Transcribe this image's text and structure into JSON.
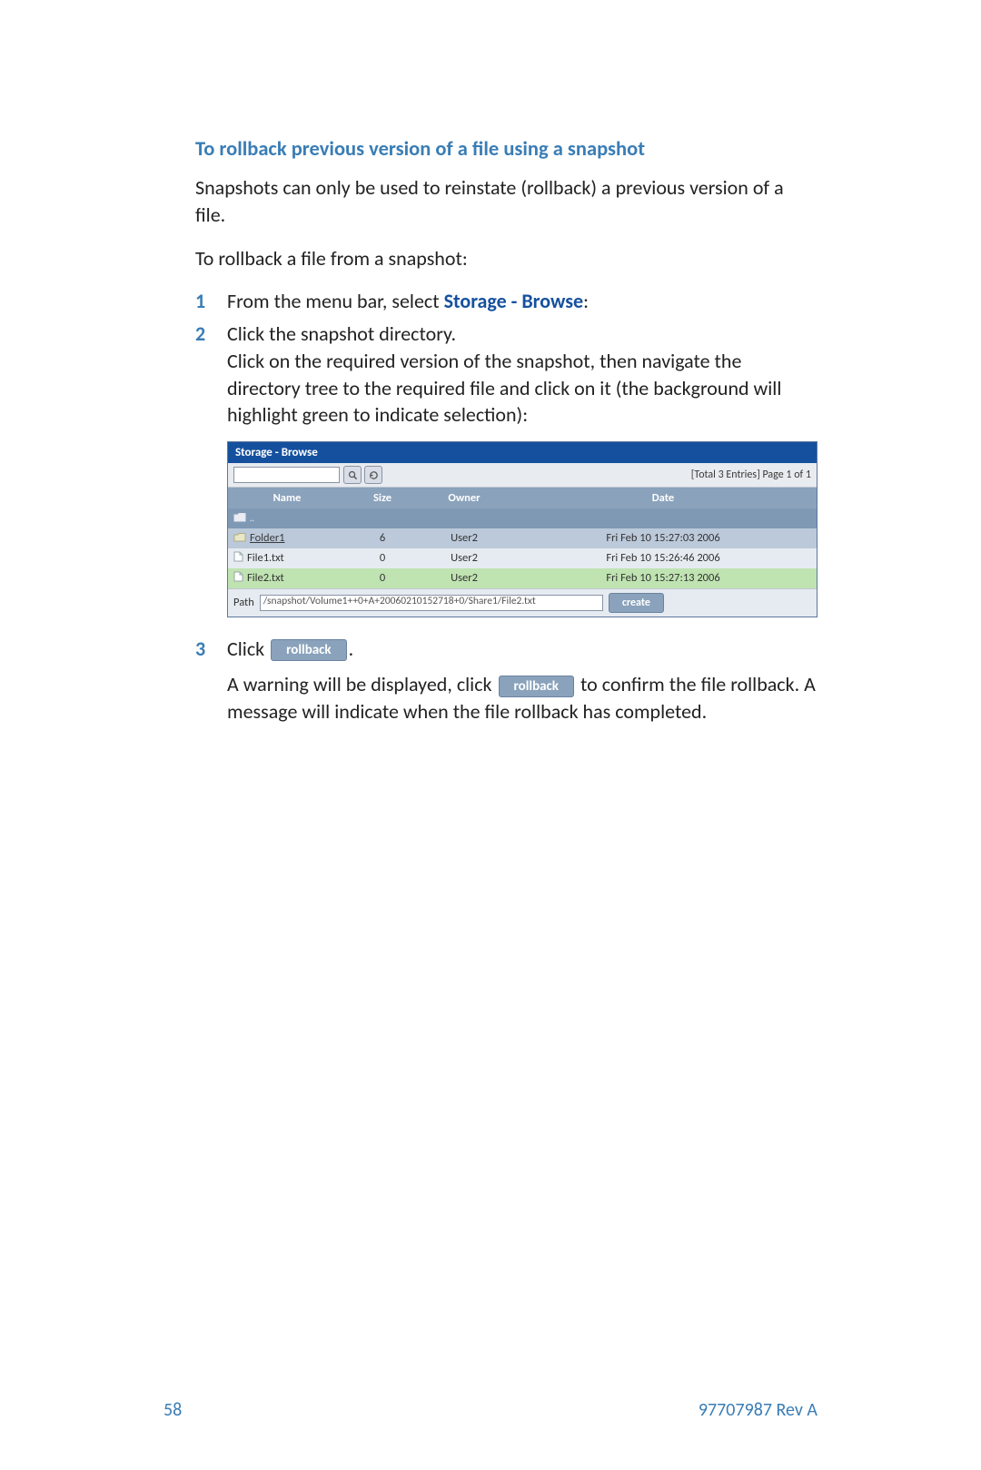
{
  "heading": "To rollback previous version of a file using a snapshot",
  "intro1": "Snapshots can only be used to reinstate (rollback) a previous version of a file.",
  "intro2": "To rollback a file from a snapshot:",
  "steps": {
    "s1": {
      "num": "1",
      "prefix": "From the menu bar, select ",
      "link": "Storage - Browse",
      "suffix": ":"
    },
    "s2": {
      "num": "2",
      "line1": "Click the snapshot directory.",
      "line2": "Click on the required version of the snapshot, then navigate the directory tree to the required file and click on it (the background will highlight green to indicate selection):"
    },
    "s3": {
      "num": "3",
      "click_word": "Click ",
      "btn1": "rollback",
      "period": ".",
      "warn_pre": "A warning will be displayed, click ",
      "btn2": "rollback",
      "warn_post": " to confirm the file rollback. A message will indicate when the file rollback has completed."
    }
  },
  "shot": {
    "title": "Storage - Browse",
    "page_info": "[Total 3 Entries] Page 1 of 1",
    "headers": {
      "name": "Name",
      "size": "Size",
      "owner": "Owner",
      "date": "Date"
    },
    "up_label": "..",
    "rows": [
      {
        "name": "Folder1",
        "size": "6",
        "owner": "User2",
        "date": "Fri Feb 10 15:27:03 2006",
        "kind": "folder",
        "cls": "row-a"
      },
      {
        "name": "File1.txt",
        "size": "0",
        "owner": "User2",
        "date": "Fri Feb 10 15:26:46 2006",
        "kind": "file",
        "cls": "row-b"
      },
      {
        "name": "File2.txt",
        "size": "0",
        "owner": "User2",
        "date": "Fri Feb 10 15:27:13 2006",
        "kind": "file",
        "cls": "row-sel"
      }
    ],
    "path_label": "Path",
    "path_value": "/snapshot/Volume1++0+A+20060210152718+0/Share1/File2.txt",
    "create_btn": "create"
  },
  "footer": {
    "page_num": "58",
    "doc_rev": "97707987 Rev A"
  }
}
